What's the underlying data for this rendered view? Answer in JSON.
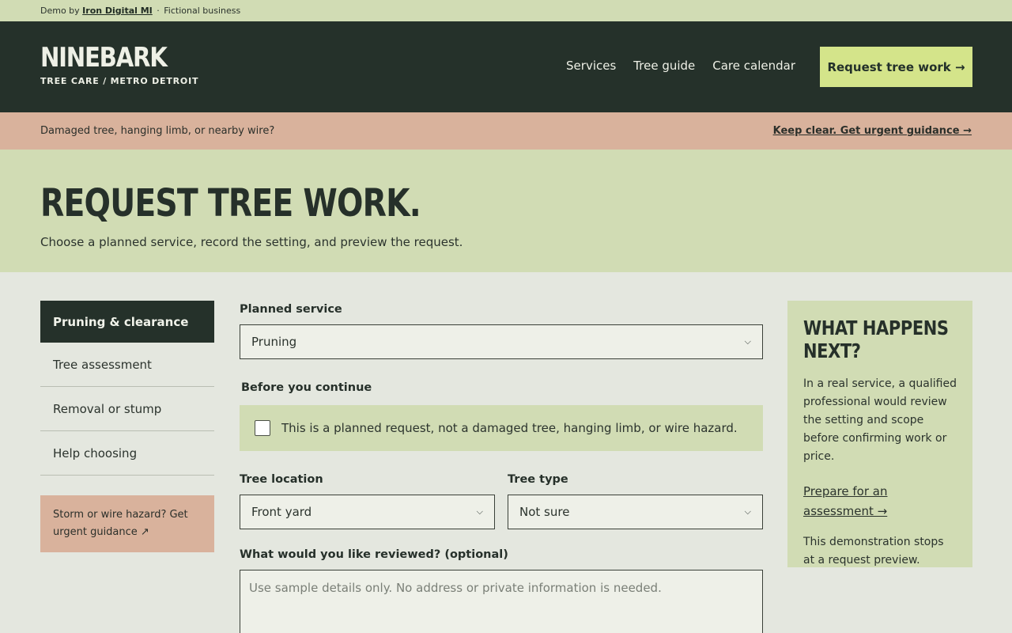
{
  "topbar": {
    "prefix": "Demo by",
    "link": "Iron Digital MI",
    "separator": "·",
    "suffix": "Fictional business"
  },
  "header": {
    "brand": "NINEBARK",
    "tagline": "TREE CARE / METRO DETROIT",
    "nav": [
      "Services",
      "Tree guide",
      "Care calendar"
    ],
    "cta": "Request tree work →"
  },
  "alert": {
    "text": "Damaged tree, hanging limb, or nearby wire?",
    "link": "Keep clear. Get urgent guidance →"
  },
  "hero": {
    "title": "REQUEST TREE WORK.",
    "subtitle": "Choose a planned service, record the setting, and preview the request."
  },
  "sidenav": {
    "items": [
      "Pruning & clearance",
      "Tree assessment",
      "Removal or stump",
      "Help choosing"
    ],
    "hazard": "Storm or wire hazard? Get urgent guidance ↗"
  },
  "form": {
    "service_label": "Planned service",
    "service_value": "Pruning",
    "continue_label": "Before you continue",
    "checkbox_text": "This is a planned request, not a damaged tree, hanging limb, or wire hazard.",
    "location_label": "Tree location",
    "location_value": "Front yard",
    "type_label": "Tree type",
    "type_value": "Not sure",
    "review_label": "What would you like reviewed? (optional)",
    "review_placeholder": "Use sample details only. No address or private information is needed."
  },
  "aside": {
    "title": "WHAT HAPPENS NEXT?",
    "body": "In a real service, a qualified professional would review the setting and scope before confirming work or price.",
    "link": "Prepare for an assessment →",
    "footer": "This demonstration stops at a request preview."
  },
  "colors": {
    "dark": "#25312a",
    "sage": "#d1dcb4",
    "blush": "#d9b29c",
    "lime": "#d4e48a",
    "page": "#e4e7df"
  }
}
